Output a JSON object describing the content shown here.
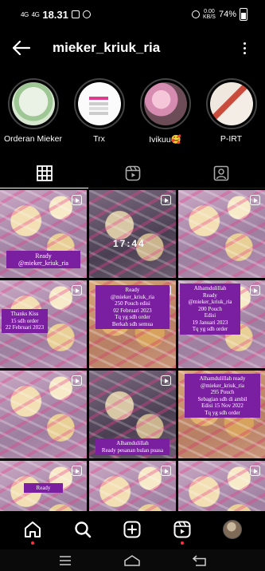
{
  "status_bar": {
    "network_1": "4G",
    "network_2": "4G",
    "time": "18.31",
    "speed_value": "0.00",
    "speed_unit": "KB/S",
    "battery": "74%"
  },
  "header": {
    "username": "mieker_kriuk_ria"
  },
  "highlights": [
    {
      "label": "Orderan Mieker"
    },
    {
      "label": "Trx"
    },
    {
      "label": "Ivikuu🥰"
    },
    {
      "label": "P-IRT"
    }
  ],
  "tabs": [
    {
      "name": "grid",
      "icon": "grid-icon",
      "active": true
    },
    {
      "name": "reels",
      "icon": "reels-icon",
      "active": false
    },
    {
      "name": "tagged",
      "icon": "tagged-icon",
      "active": false
    }
  ],
  "posts": [
    {
      "caption": "Ready\n@mieker_kriuk_ria",
      "style": "normal"
    },
    {
      "caption": "",
      "timecode": "17:44",
      "style": "dark"
    },
    {
      "caption": "",
      "style": "normal"
    },
    {
      "caption": "Thanks Kiss\n15 sdh order\n22 Februari 2023",
      "style": "normal"
    },
    {
      "caption": "Ready\n@mieker_kriuk_ria\n250 Pouch edisi\n02 Februari 2023\nTq yg sdh order\nBerkah sdh semua",
      "style": "warm"
    },
    {
      "caption": "Alhamdulillah\nReady\n@mieker_kriuk_ria\n200 Pouch\nEdisi\n19 Januari 2023\nTq yg sdh order",
      "style": "normal"
    },
    {
      "caption": "",
      "style": "normal"
    },
    {
      "caption": "Alhamdulillah\nReady pesanan bulan puasa",
      "style": "dark"
    },
    {
      "caption": "Alhamdulillah ready\n@mieker_kriuk_ria\n295 Pouch\nSebagian sdh di ambil\nEdisi 15 Nov 2022\nTq yg sdh order",
      "style": "warm"
    },
    {
      "caption": "Ready",
      "style": "normal"
    },
    {
      "caption": "",
      "style": "normal"
    },
    {
      "caption": "",
      "style": "normal"
    }
  ],
  "bottom_nav": [
    {
      "name": "home",
      "icon": "home-icon",
      "active": true,
      "notification_dot": true
    },
    {
      "name": "search",
      "icon": "search-icon"
    },
    {
      "name": "create",
      "icon": "add-post-icon"
    },
    {
      "name": "reels",
      "icon": "reels-icon",
      "notification_dot": true
    },
    {
      "name": "profile",
      "icon": "avatar"
    }
  ],
  "colors": {
    "background": "#000000",
    "caption_bg": "#7a1fa0",
    "notification": "#ff3040"
  }
}
